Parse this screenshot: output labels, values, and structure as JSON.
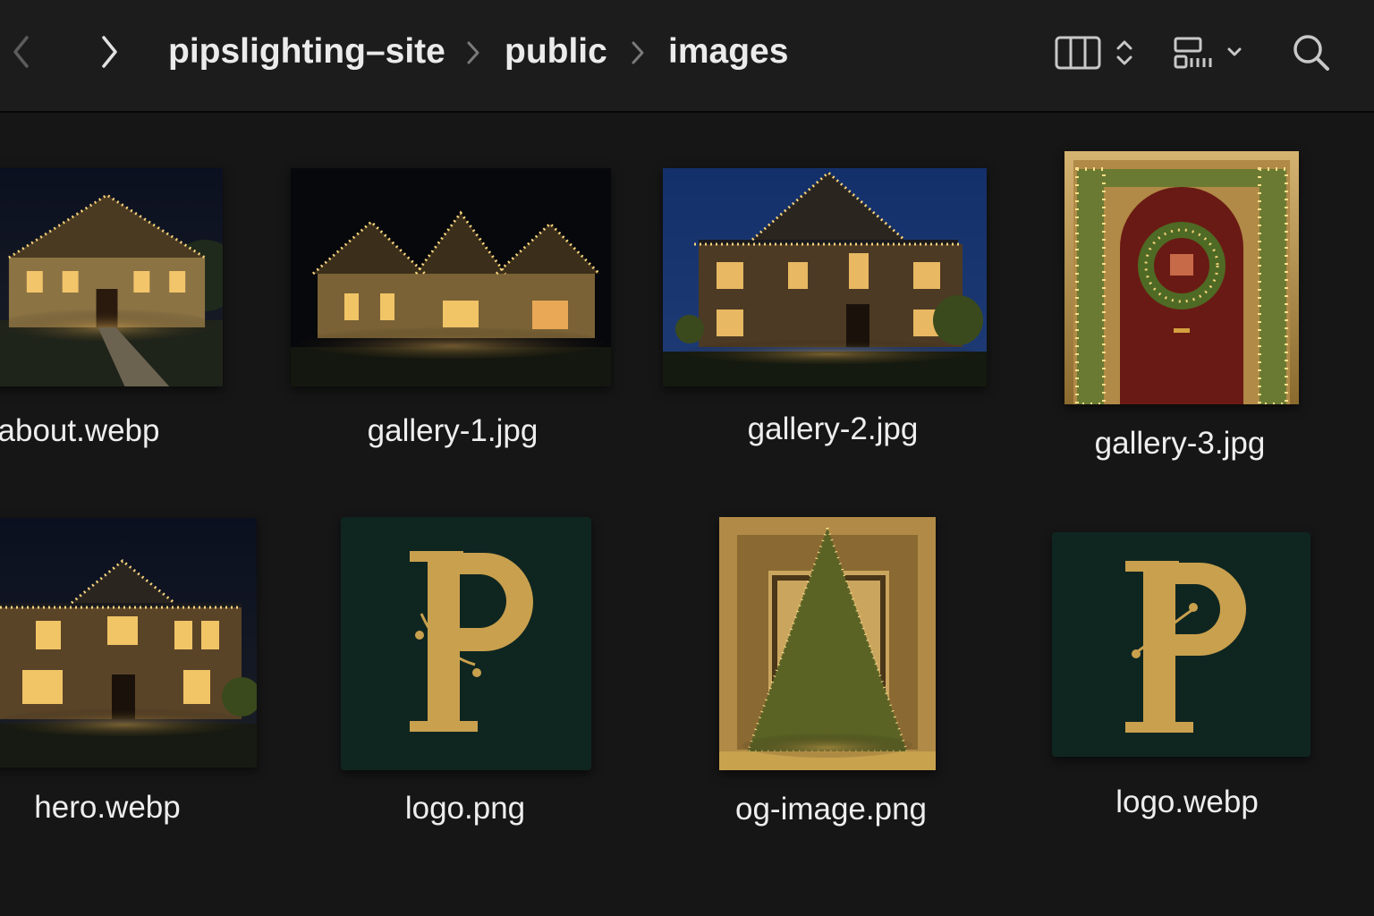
{
  "nav": {
    "back_icon": "chevron-left-icon",
    "forward_icon": "chevron-right-icon"
  },
  "breadcrumb": [
    "pipslighting–site",
    "public",
    "images"
  ],
  "toolbar": {
    "view_icon": "column-view-icon",
    "view_toggle_icon": "updown-chevron-icon",
    "group_icon": "group-by-icon",
    "group_menu_icon": "chevron-down-icon",
    "search_icon": "search-icon"
  },
  "files": [
    {
      "name": "about.webp",
      "kind": "house-night"
    },
    {
      "name": "gallery-1.jpg",
      "kind": "house-night"
    },
    {
      "name": "gallery-2.jpg",
      "kind": "house-dusk"
    },
    {
      "name": "gallery-3.jpg",
      "kind": "door-wreath"
    },
    {
      "name": "hero.webp",
      "kind": "house-night"
    },
    {
      "name": "logo.png",
      "kind": "logo"
    },
    {
      "name": "og-image.png",
      "kind": "tree"
    },
    {
      "name": "logo.webp",
      "kind": "logo"
    }
  ],
  "colors": {
    "background": "#161616",
    "toolbar": "#1c1c1c",
    "gold": "#c9a04e",
    "logo_bg": "#0f2620"
  }
}
